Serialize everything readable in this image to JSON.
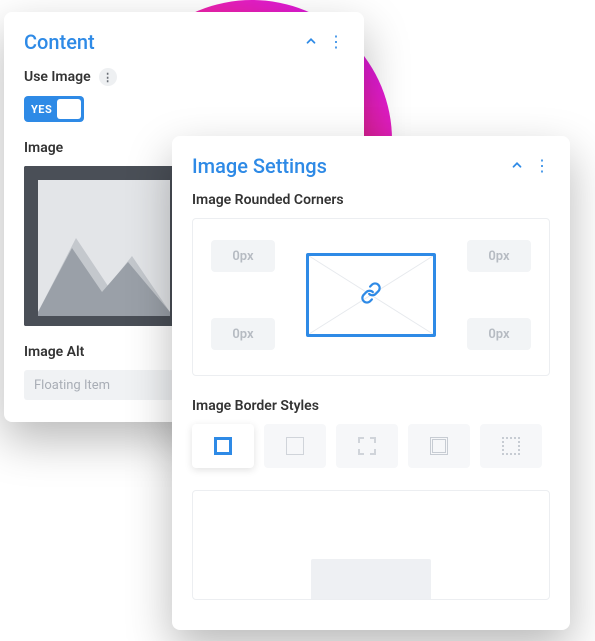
{
  "content": {
    "title": "Content",
    "use_image_label": "Use Image",
    "toggle_value": "YES",
    "image_label": "Image",
    "image_alt_label": "Image Alt",
    "image_alt_value": "Floating Item"
  },
  "settings": {
    "title": "Image Settings",
    "rounded_label": "Image Rounded Corners",
    "corners": {
      "tl": "0px",
      "tr": "0px",
      "bl": "0px",
      "br": "0px"
    },
    "border_styles_label": "Image Border Styles"
  }
}
